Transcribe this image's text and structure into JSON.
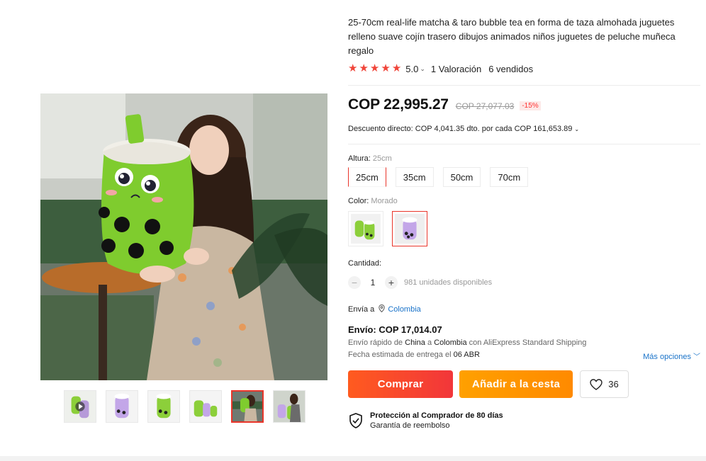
{
  "product": {
    "title": "25-70cm real-life matcha & taro bubble tea en forma de taza almohada juguetes relleno suave cojín trasero dibujos animados niños juguetes de peluche muñeca regalo",
    "rating_score": "5.0",
    "reviews": "1 Valoración",
    "sold": "6 vendidos",
    "stars": 5
  },
  "pricing": {
    "price": "COP 22,995.27",
    "old_price": "COP 27,077.03",
    "discount": "-15%",
    "coupon": "Descuento directo: COP 4,041.35 dto. por cada COP 161,653.89"
  },
  "sku": {
    "size_label": "Altura:",
    "size_selected": "25cm",
    "sizes": [
      "25cm",
      "35cm",
      "50cm",
      "70cm"
    ],
    "color_label": "Color:",
    "color_selected": "Morado",
    "colors": [
      "Verde",
      "Morado"
    ]
  },
  "quantity": {
    "label": "Cantidad:",
    "minus": "−",
    "value": "1",
    "plus": "+",
    "available": "981 unidades disponibles"
  },
  "shipping": {
    "ship_to_label": "Envía a",
    "ship_to_country": "Colombia",
    "cost": "Envío: COP 17,014.07",
    "line_prefix": "Envío rápido de",
    "from": "China",
    "line_mid": "a",
    "to": "Colombia",
    "line_suffix": "con AliExpress Standard Shipping",
    "date_prefix": "Fecha estimada de entrega el",
    "date": "06 ABR",
    "more_options": "Más opciones"
  },
  "actions": {
    "buy": "Comprar",
    "add_to_cart": "Añadir a la cesta",
    "wishlist_count": "36"
  },
  "protection": {
    "title": "Protección al Comprador de 80 días",
    "subtitle": "Garantía de reembolso"
  },
  "gallery": {
    "thumbnails": 6,
    "active_thumbnail": 5
  },
  "colors": {
    "accent": "#e9352a",
    "buy_button": "#f2363a",
    "cart_button": "#ff8a00",
    "link": "#1a73c9",
    "star": "#f0453a"
  }
}
